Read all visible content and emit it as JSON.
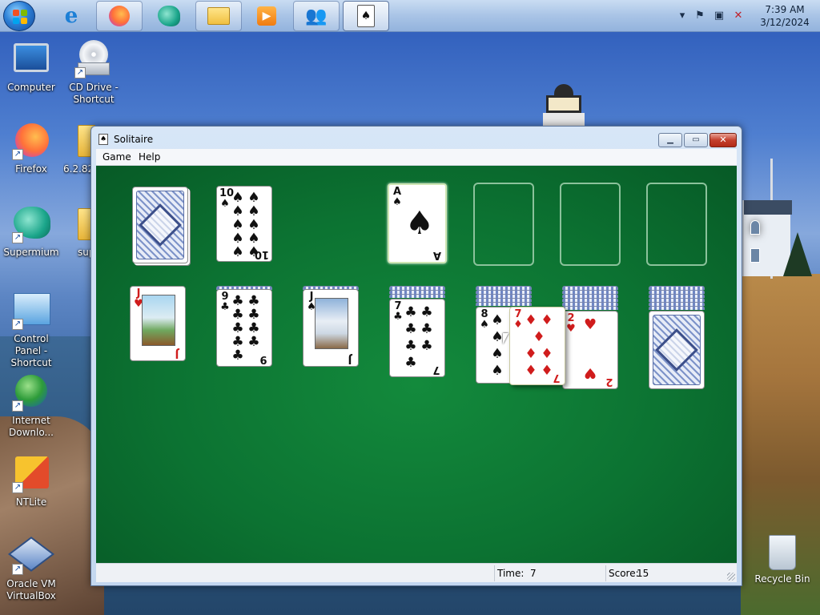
{
  "taskbar": {
    "clock_time": "7:39 AM",
    "clock_date": "3/12/2024",
    "pinned": [
      {
        "name": "internet-explorer-icon",
        "glyph": "e",
        "open": false
      },
      {
        "name": "firefox-icon",
        "glyph": "🦊",
        "open": true
      },
      {
        "name": "supermium-icon",
        "glyph": "◉",
        "open": false
      },
      {
        "name": "file-explorer-icon",
        "glyph": "📁",
        "open": true
      },
      {
        "name": "media-player-icon",
        "glyph": "▶",
        "open": false
      },
      {
        "name": "users-icon",
        "glyph": "👥",
        "open": true
      },
      {
        "name": "solitaire-icon",
        "glyph": "♠",
        "open": true
      }
    ]
  },
  "desktop": {
    "icons": [
      {
        "label": "Computer"
      },
      {
        "label": "CD Drive - Shortcut"
      },
      {
        "label": "Firefox"
      },
      {
        "label": "6.2.82"
      },
      {
        "label": "Supermium"
      },
      {
        "label": "sup"
      },
      {
        "label": "Control Panel - Shortcut"
      },
      {
        "label": "Internet Downlo..."
      },
      {
        "label": "NTLite"
      },
      {
        "label": "Oracle VM VirtualBox"
      },
      {
        "label": "Recycle Bin"
      }
    ]
  },
  "window": {
    "title": "Solitaire",
    "menu": {
      "game": "Game",
      "help": "Help"
    },
    "status": {
      "time_label": "Time:",
      "time_value": "7",
      "score_label": "Score:",
      "score_value": "15"
    }
  },
  "cards": {
    "stock": "deck-back",
    "waste": {
      "rank": "10",
      "suit": "♠"
    },
    "foundation1": {
      "rank": "A",
      "suit": "♠"
    },
    "tableau": [
      {
        "rank": "J",
        "suit": "♥"
      },
      {
        "rank": "9",
        "suit": "♣"
      },
      {
        "rank": "J",
        "suit": "♠"
      },
      {
        "rank": "7",
        "suit": "♣"
      },
      {
        "rank": "8",
        "suit": "♠"
      },
      {
        "rank": "2",
        "suit": "♥"
      },
      {
        "rank": "",
        "suit": ""
      }
    ],
    "dragging": {
      "rank": "7",
      "suit": "♦"
    }
  },
  "colors": {
    "felt": "#0c7332",
    "red_suit": "#d01c1c",
    "black_suit": "#111111"
  }
}
